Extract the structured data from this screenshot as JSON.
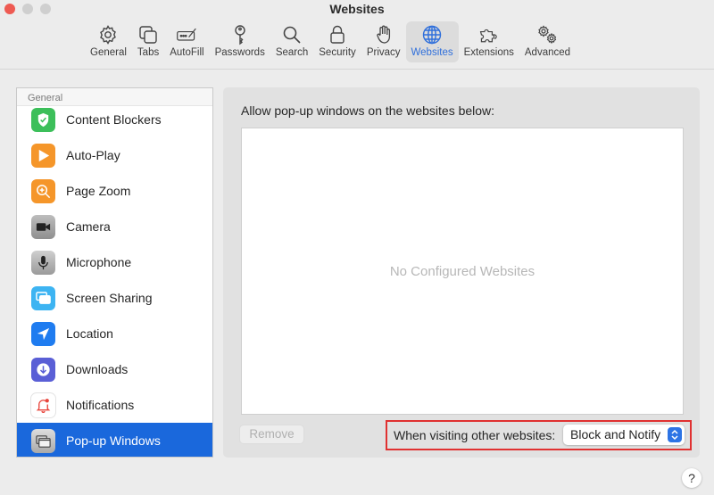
{
  "window": {
    "title": "Websites"
  },
  "toolbar": {
    "items": [
      {
        "label": "General",
        "icon": "gear-icon"
      },
      {
        "label": "Tabs",
        "icon": "tabs-icon"
      },
      {
        "label": "AutoFill",
        "icon": "autofill-icon"
      },
      {
        "label": "Passwords",
        "icon": "key-icon"
      },
      {
        "label": "Search",
        "icon": "search-icon"
      },
      {
        "label": "Security",
        "icon": "lock-icon"
      },
      {
        "label": "Privacy",
        "icon": "hand-icon"
      },
      {
        "label": "Websites",
        "icon": "globe-icon",
        "active": true
      },
      {
        "label": "Extensions",
        "icon": "puzzle-icon"
      },
      {
        "label": "Advanced",
        "icon": "gears-icon"
      }
    ],
    "active_color": "#2f6fdb"
  },
  "sidebar": {
    "section_header": "General",
    "items": [
      {
        "label": "Content Blockers",
        "icon": "shield-check-icon",
        "color": "#3cbf5a"
      },
      {
        "label": "Auto-Play",
        "icon": "play-icon",
        "color": "#f5962a"
      },
      {
        "label": "Page Zoom",
        "icon": "zoom-icon",
        "color": "#f5962a"
      },
      {
        "label": "Camera",
        "icon": "camera-icon",
        "color": "#9c9c9c"
      },
      {
        "label": "Microphone",
        "icon": "microphone-icon",
        "color": "#9c9c9c"
      },
      {
        "label": "Screen Sharing",
        "icon": "screen-sharing-icon",
        "color": "#3db4f2"
      },
      {
        "label": "Location",
        "icon": "location-icon",
        "color": "#1f7cf0"
      },
      {
        "label": "Downloads",
        "icon": "download-icon",
        "color": "#5a5fd6"
      },
      {
        "label": "Notifications",
        "icon": "bell-icon",
        "color": "#ffffff"
      },
      {
        "label": "Pop-up Windows",
        "icon": "popup-windows-icon",
        "color": "#b5b5b5",
        "selected": true
      }
    ],
    "selected_color": "#1a68dc"
  },
  "main": {
    "list_label": "Allow pop-up windows on the websites below:",
    "empty_text": "No Configured Websites",
    "remove_button": "Remove",
    "policy_label": "When visiting other websites:",
    "policy_value": "Block and Notify",
    "help_label": "?"
  }
}
